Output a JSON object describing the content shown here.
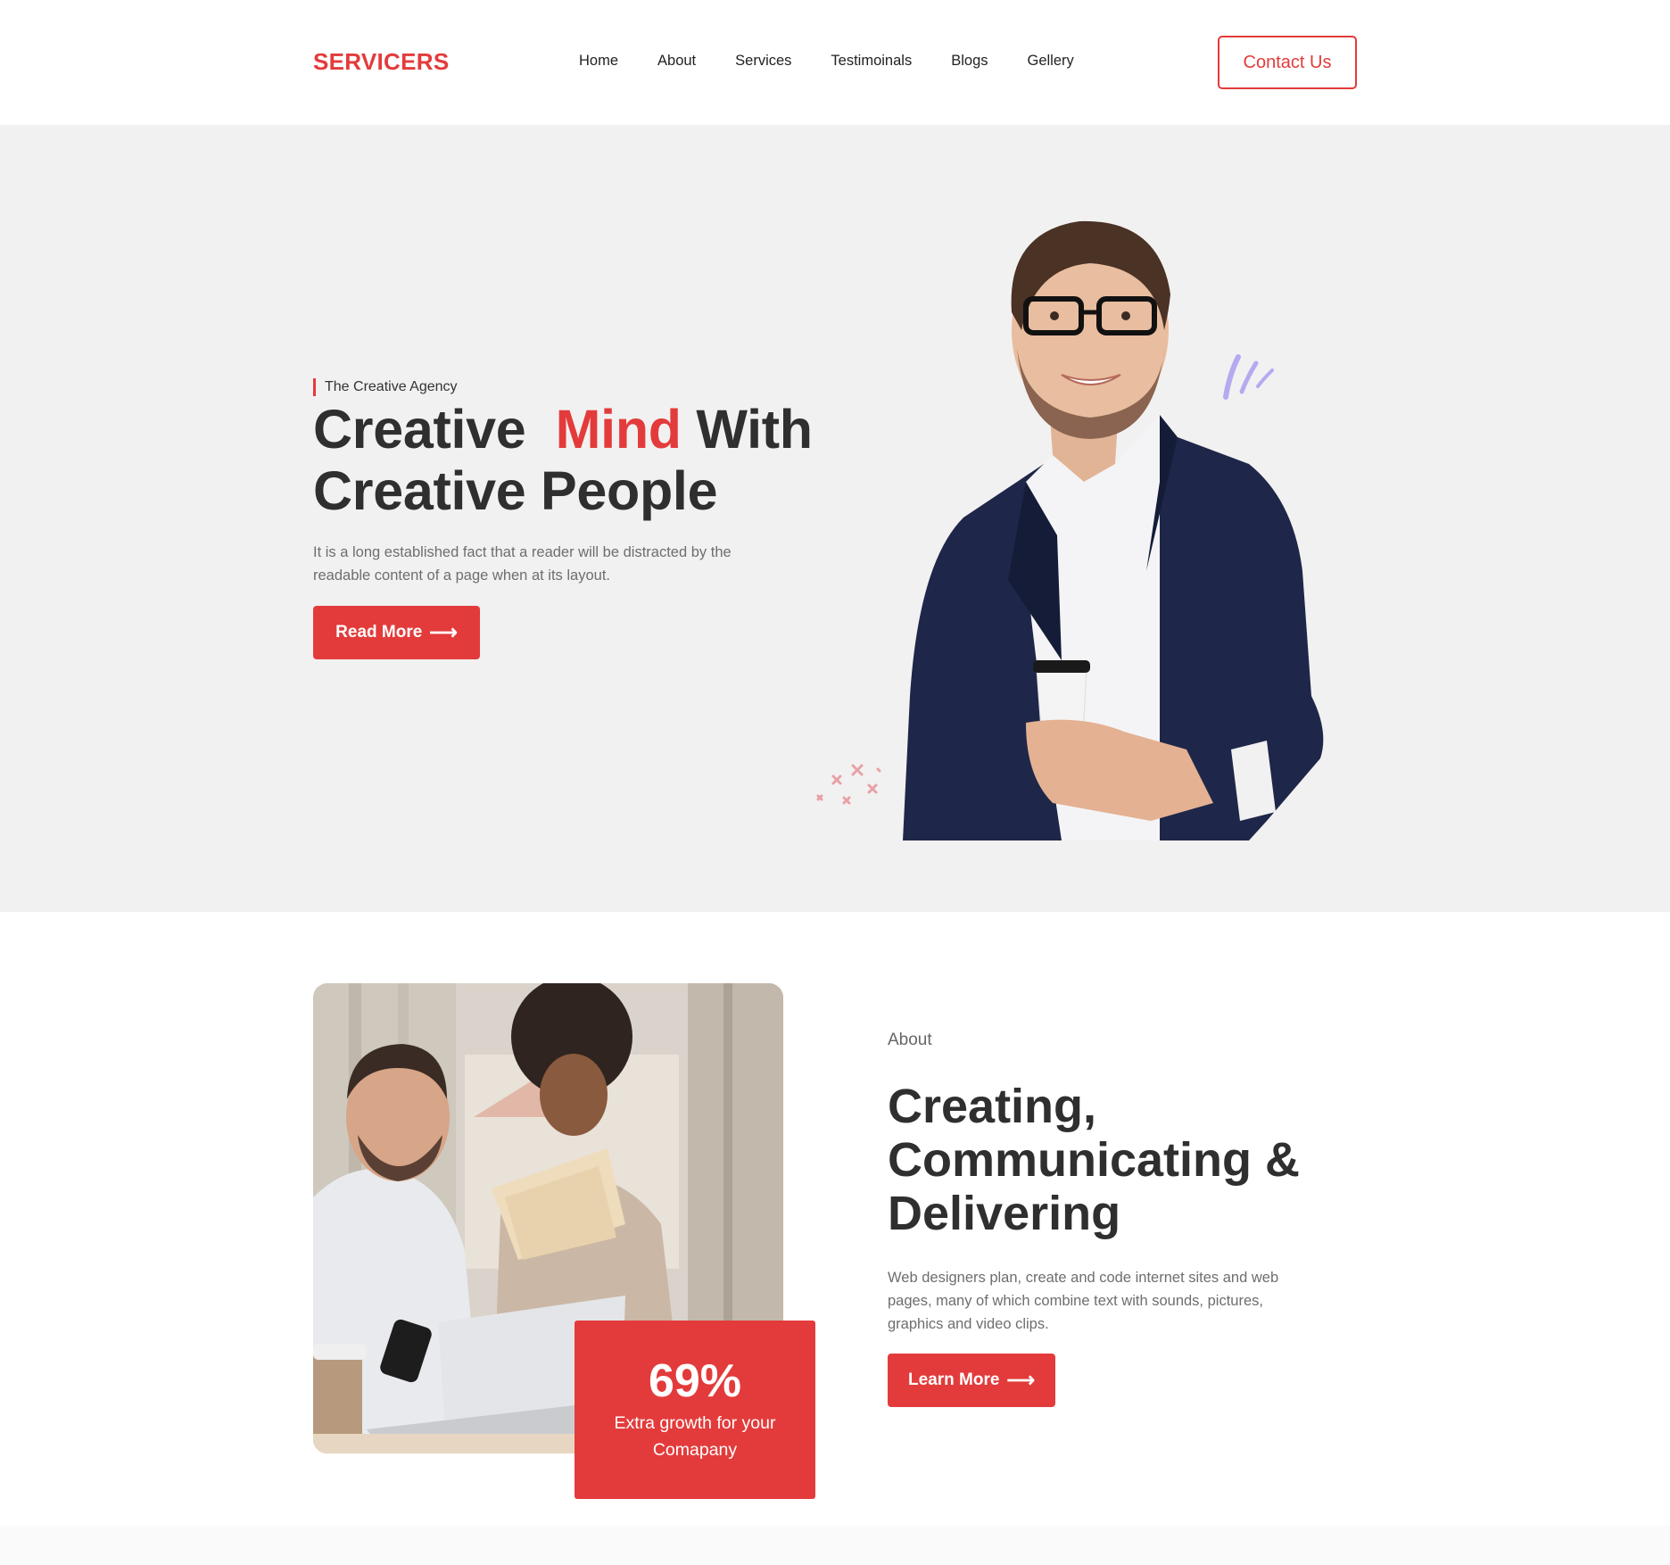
{
  "brand": {
    "name": "SERVICERS",
    "accent_color": "#e33b3b"
  },
  "nav": {
    "items": [
      {
        "label": "Home"
      },
      {
        "label": "About"
      },
      {
        "label": "Services"
      },
      {
        "label": "Testimoinals"
      },
      {
        "label": "Blogs"
      },
      {
        "label": "Gellery"
      }
    ],
    "contact_label": "Contact Us"
  },
  "hero": {
    "eyebrow": "The Creative Agency",
    "title_part1": "Creative",
    "title_accent": "Mind",
    "title_part2": "With",
    "title_line2": "Creative People",
    "description": "It is a long established fact that a reader will be distracted by the readable content of a page when at its layout.",
    "button_label": "Read More",
    "button_icon": "arrow-right-icon",
    "background_color": "#f2f1f1",
    "image": "man-with-coffee-portrait"
  },
  "about": {
    "eyebrow": "About",
    "title": "Creating, Communicating & Delivering",
    "description": "Web designers plan, create and code internet sites and web pages, many of which combine text with sounds, pictures, graphics and video clips.",
    "button_label": "Learn More",
    "button_icon": "arrow-right-icon",
    "image": "two-people-working-laptop",
    "stat": {
      "value": "69%",
      "label": "Extra growth for your Comapany"
    }
  }
}
